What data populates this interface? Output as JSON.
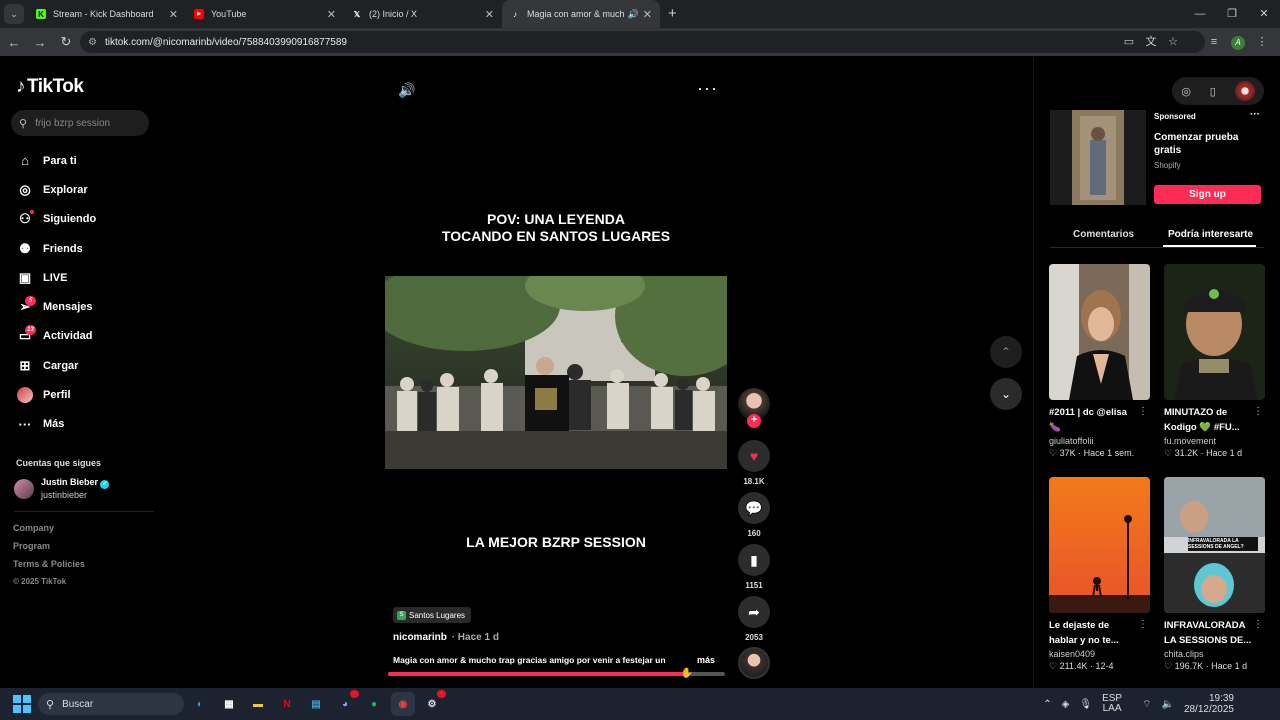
{
  "browser": {
    "tabs": [
      {
        "title": "Stream - Kick Dashboard",
        "icon": "kick-icon",
        "active": false
      },
      {
        "title": "YouTube",
        "icon": "youtube-icon",
        "active": false
      },
      {
        "title": "(2) Inicio / X",
        "icon": "x-icon",
        "active": false
      },
      {
        "title": "Magia con amor & mucho t",
        "icon": "tiktok-icon",
        "active": true
      }
    ],
    "url": "tiktok.com/@nicomarinb/video/7588403990916877589"
  },
  "sidebar": {
    "logo": "TikTok",
    "search_placeholder": "frijo bzrp session",
    "menu": [
      {
        "label": "Para ti",
        "icon": "home-icon",
        "glyph": "⌂"
      },
      {
        "label": "Explorar",
        "icon": "compass-icon",
        "glyph": "◎"
      },
      {
        "label": "Siguiendo",
        "icon": "following-icon",
        "glyph": "👤"
      },
      {
        "label": "Friends",
        "icon": "friends-icon",
        "glyph": "👥"
      },
      {
        "label": "LIVE",
        "icon": "live-icon",
        "glyph": "▣"
      },
      {
        "label": "Mensajes",
        "icon": "messages-icon",
        "glyph": "➢",
        "badge": "5"
      },
      {
        "label": "Actividad",
        "icon": "activity-icon",
        "glyph": "▭",
        "badge": "13"
      },
      {
        "label": "Cargar",
        "icon": "upload-icon",
        "glyph": "⊞"
      },
      {
        "label": "Perfil",
        "icon": "profile-avatar-icon",
        "glyph": ""
      },
      {
        "label": "Más",
        "icon": "more-icon",
        "glyph": "···"
      }
    ],
    "following_title": "Cuentas que sigues",
    "following": [
      {
        "name": "Justin Bieber",
        "handle": "justinbieber"
      }
    ],
    "footer": [
      "Company",
      "Program",
      "Terms & Policies"
    ],
    "copyright": "© 2025 TikTok"
  },
  "video": {
    "caption_top_line1": "POV: UNA LEYENDA",
    "caption_top_line2": "TOCANDO EN SANTOS LUGARES",
    "caption_bottom": "LA MEJOR BZRP SESSION",
    "place": "Santos Lugares",
    "author": "nicomarinb",
    "time": "· Hace 1 d",
    "description": "Magia con amor & mucho trap gracias amigo por venir a festejar un",
    "more": "más",
    "progress": 0.88,
    "likes": "18.1K",
    "comments": "160",
    "saves": "1151",
    "shares": "2053"
  },
  "panel": {
    "sponsored": "Sponsored",
    "ad_title": "Comenzar prueba gratis",
    "ad_brand": "Shopify",
    "ad_button": "Sign up",
    "tabs": [
      "Comentarios",
      "Podría interesarte"
    ],
    "cards": [
      {
        "title": "#2011 | dc @elisa 🍆",
        "author": "giuliatoffolii",
        "likes": "37K",
        "time": "Hace 1 sem."
      },
      {
        "title": "MINUTAZO de Kodigo 💚 #FU...",
        "author": "fu.movement",
        "likes": "31.2K",
        "time": "Hace 1 d"
      },
      {
        "title": "Le dejaste de hablar y no te...",
        "author": "kaisen0409",
        "likes": "211.4K",
        "time": "12-4"
      },
      {
        "title": "INFRAVALORADA LA SESSIONS DE...",
        "author": "chita.clips",
        "likes": "196.7K",
        "time": "Hace 1 d"
      }
    ],
    "thumb_text": "INFRAVALORADA LA SESSIONS DE ANGEL?"
  },
  "taskbar": {
    "search": "Buscar",
    "lang_line1": "ESP",
    "lang_line2": "LAA",
    "time": "19:39",
    "date": "28/12/2025"
  }
}
